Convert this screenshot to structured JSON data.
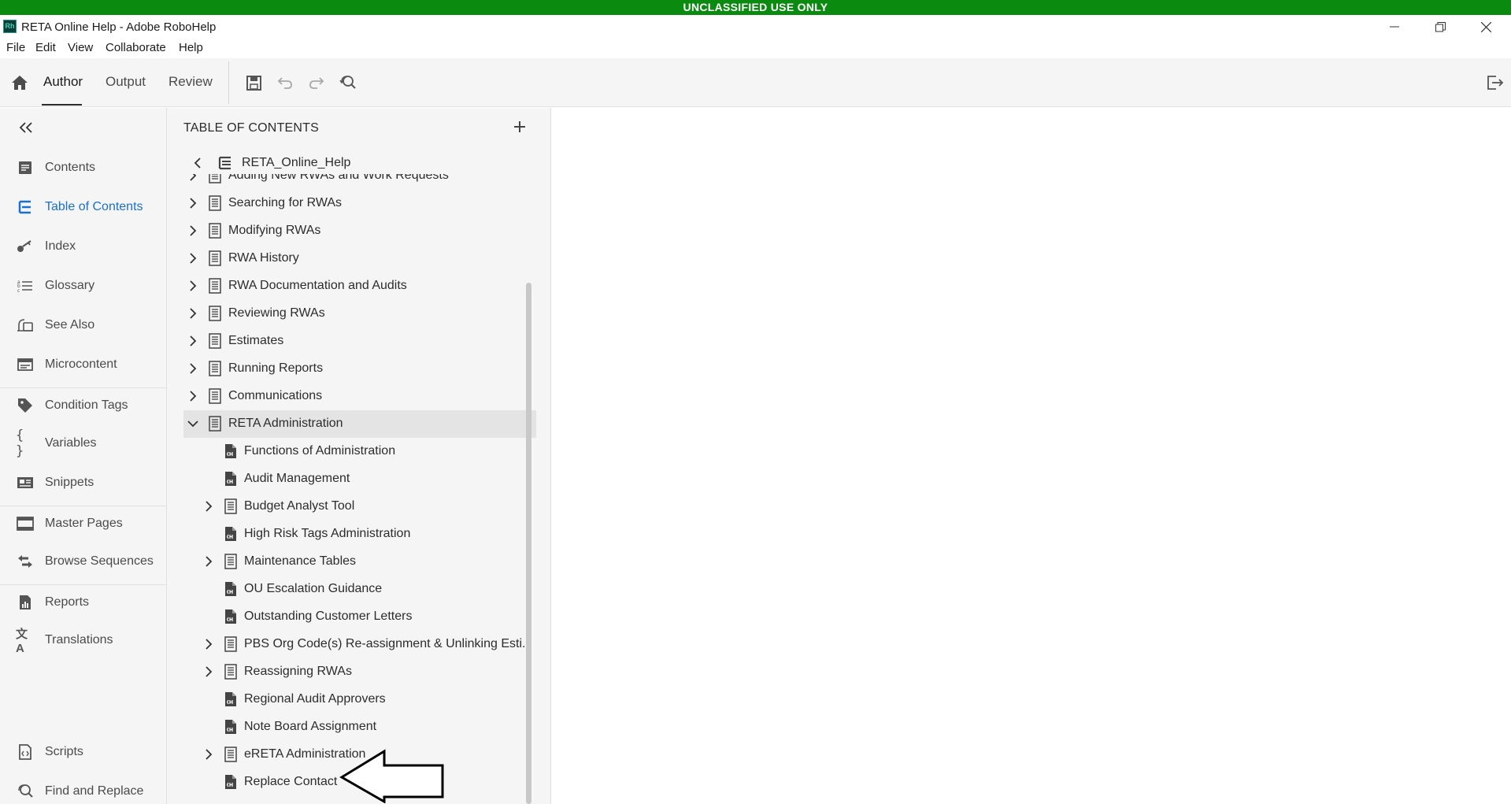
{
  "banner": {
    "text": "UNCLASSIFIED USE ONLY",
    "color": "#0b8a10"
  },
  "window": {
    "app_icon_text": "Rh",
    "title": "RETA Online Help - Adobe RoboHelp"
  },
  "menu": {
    "items": [
      "File",
      "Edit",
      "View",
      "Collaborate",
      "Help"
    ]
  },
  "toolbar": {
    "tabs": [
      {
        "label": "Author",
        "active": true
      },
      {
        "label": "Output",
        "active": false
      },
      {
        "label": "Review",
        "active": false
      }
    ],
    "icons": [
      "home-icon",
      "save-icon",
      "undo-icon",
      "redo-icon",
      "find-replace-icon",
      "exit-icon"
    ]
  },
  "leftnav": {
    "collapse_icon": "double-chevron-left-icon",
    "items": [
      {
        "label": "Contents",
        "icon": "contents-icon",
        "active": false
      },
      {
        "label": "Table of Contents",
        "icon": "toc-icon",
        "active": true
      },
      {
        "label": "Index",
        "icon": "key-icon",
        "active": false
      },
      {
        "label": "Glossary",
        "icon": "glossary-icon",
        "active": false
      },
      {
        "label": "See Also",
        "icon": "see-also-icon",
        "active": false
      },
      {
        "label": "Microcontent",
        "icon": "microcontent-icon",
        "active": false
      },
      {
        "label": "Condition Tags",
        "icon": "tag-icon",
        "active": false
      },
      {
        "label": "Variables",
        "icon": "braces-icon",
        "active": false
      },
      {
        "label": "Snippets",
        "icon": "snippet-icon",
        "active": false
      },
      {
        "label": "Master Pages",
        "icon": "master-page-icon",
        "active": false
      },
      {
        "label": "Browse Sequences",
        "icon": "browse-sequence-icon",
        "active": false
      },
      {
        "label": "Reports",
        "icon": "report-icon",
        "active": false
      },
      {
        "label": "Translations",
        "icon": "translate-icon",
        "active": false
      },
      {
        "label": "Scripts",
        "icon": "script-icon",
        "active": false
      },
      {
        "label": "Find and Replace",
        "icon": "find-replace-icon",
        "active": false
      }
    ]
  },
  "toc": {
    "header": "TABLE OF CONTENTS",
    "root_label": "RETA_Online_Help",
    "items": [
      {
        "label": "Adding New RWAs and Work Requests",
        "level": 0,
        "type": "book",
        "expandable": true,
        "expanded": false
      },
      {
        "label": "Searching for RWAs",
        "level": 0,
        "type": "book",
        "expandable": true,
        "expanded": false
      },
      {
        "label": "Modifying RWAs",
        "level": 0,
        "type": "book",
        "expandable": true,
        "expanded": false
      },
      {
        "label": "RWA History",
        "level": 0,
        "type": "book",
        "expandable": true,
        "expanded": false
      },
      {
        "label": "RWA Documentation and Audits",
        "level": 0,
        "type": "book",
        "expandable": true,
        "expanded": false
      },
      {
        "label": "Reviewing RWAs",
        "level": 0,
        "type": "book",
        "expandable": true,
        "expanded": false
      },
      {
        "label": "Estimates",
        "level": 0,
        "type": "book",
        "expandable": true,
        "expanded": false
      },
      {
        "label": "Running Reports",
        "level": 0,
        "type": "book",
        "expandable": true,
        "expanded": false
      },
      {
        "label": "Communications",
        "level": 0,
        "type": "book",
        "expandable": true,
        "expanded": false
      },
      {
        "label": "RETA Administration",
        "level": 0,
        "type": "book",
        "expandable": true,
        "expanded": true,
        "selected": true
      },
      {
        "label": "Functions of Administration",
        "level": 1,
        "type": "topic",
        "expandable": false
      },
      {
        "label": "Audit Management",
        "level": 1,
        "type": "topic",
        "expandable": false
      },
      {
        "label": "Budget Analyst Tool",
        "level": 1,
        "type": "book",
        "expandable": true,
        "expanded": false
      },
      {
        "label": "High Risk Tags Administration",
        "level": 1,
        "type": "topic",
        "expandable": false
      },
      {
        "label": "Maintenance Tables",
        "level": 1,
        "type": "book",
        "expandable": true,
        "expanded": false
      },
      {
        "label": "OU Escalation Guidance",
        "level": 1,
        "type": "topic",
        "expandable": false
      },
      {
        "label": "Outstanding Customer Letters",
        "level": 1,
        "type": "topic",
        "expandable": false
      },
      {
        "label": "PBS Org Code(s) Re-assignment & Unlinking Esti...",
        "level": 1,
        "type": "book",
        "expandable": true,
        "expanded": false
      },
      {
        "label": "Reassigning RWAs",
        "level": 1,
        "type": "book",
        "expandable": true,
        "expanded": false
      },
      {
        "label": "Regional Audit Approvers",
        "level": 1,
        "type": "topic",
        "expandable": false
      },
      {
        "label": "Note Board Assignment",
        "level": 1,
        "type": "topic",
        "expandable": false
      },
      {
        "label": "eRETA Administration",
        "level": 1,
        "type": "book",
        "expandable": true,
        "expanded": false
      },
      {
        "label": "Replace Contact",
        "level": 1,
        "type": "topic",
        "expandable": false
      }
    ]
  },
  "annotation": {
    "icon": "arrow-left-icon"
  }
}
